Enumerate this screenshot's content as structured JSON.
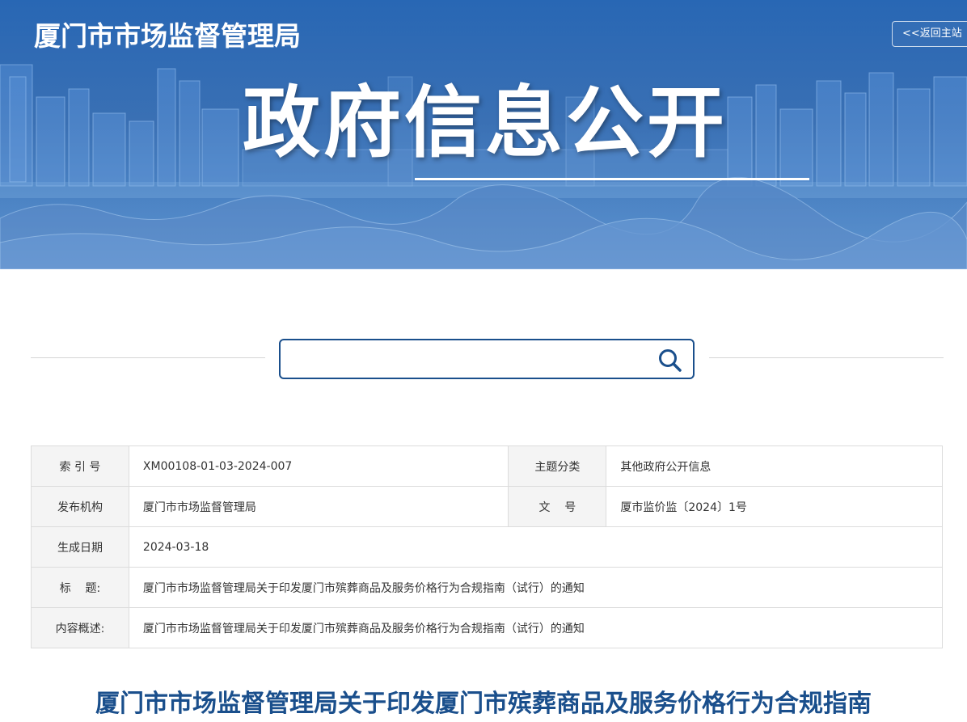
{
  "header": {
    "site_title": "厦门市市场监督管理局",
    "home_link": "<<返回主站",
    "hero_title": "政府信息公开"
  },
  "search": {
    "value": "",
    "placeholder": "",
    "icon": "search-icon"
  },
  "info": {
    "index_label": "索 引 号",
    "index_value": "XM00108-01-03-2024-007",
    "category_label": "主题分类",
    "category_value": "其他政府公开信息",
    "publisher_label": "发布机构",
    "publisher_value": "厦门市市场监督管理局",
    "doc_no_label": "文    号",
    "doc_no_value": "厦市监价监〔2024〕1号",
    "date_label": "生成日期",
    "date_value": "2024-03-18",
    "title_label": "标    题:",
    "title_value": "厦门市市场监督管理局关于印发厦门市殡葬商品及服务价格行为合规指南（试行）的通知",
    "summary_label": "内容概述:",
    "summary_value": "厦门市市场监督管理局关于印发厦门市殡葬商品及服务价格行为合规指南（试行）的通知"
  },
  "article": {
    "heading": "厦门市市场监督管理局关于印发厦门市殡葬商品及服务价格行为合规指南"
  },
  "colors": {
    "banner_blue": "#1d5fb0",
    "accent_navy": "#1a4f8c",
    "label_bg": "#f4f4f4",
    "border": "#dcdcdc"
  }
}
